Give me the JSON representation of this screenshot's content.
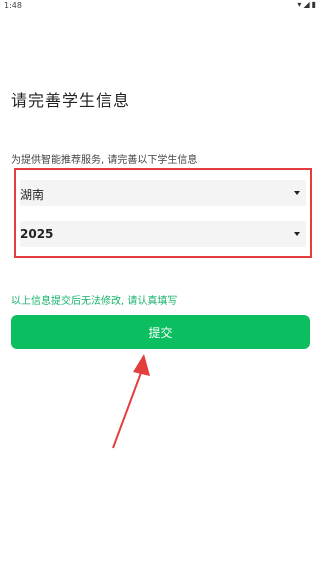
{
  "status_bar": {
    "time": "1:48",
    "icons": [
      "wifi-icon",
      "signal-icon",
      "battery-icon"
    ]
  },
  "page": {
    "title": "请完善学生信息",
    "subtitle": "为提供智能推荐服务, 请完善以下学生信息"
  },
  "form": {
    "province": {
      "selected": "湖南"
    },
    "year": {
      "selected": "2025"
    },
    "notice": "以上信息提交后无法修改, 请认真填写",
    "submit_label": "提交"
  },
  "colors": {
    "accent_green": "#0bbf61",
    "notice_green": "#17b36a",
    "annotation_red": "#e43d3d"
  }
}
